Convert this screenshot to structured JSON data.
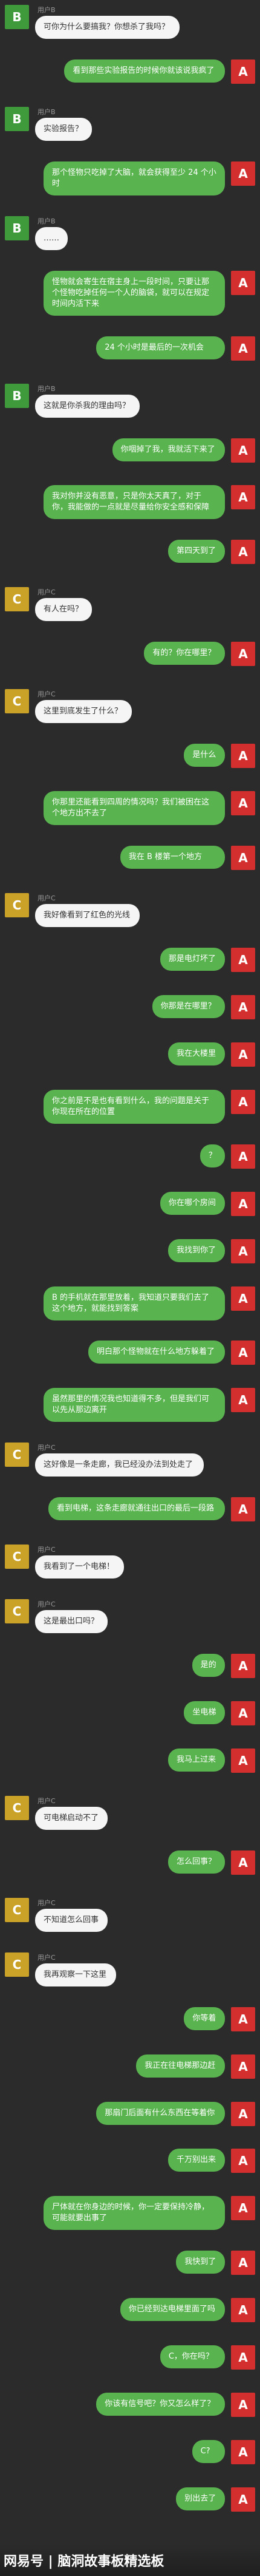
{
  "colors": {
    "background": "#2b2b2b",
    "green_avatar": "#3e9a3a",
    "red_avatar": "#d32f2f",
    "yellow_avatar": "#c9a227",
    "green_bubble": "#59b34f",
    "white_bubble": "#f5f5f5"
  },
  "messages": [
    {
      "side": "left",
      "avatar": "B",
      "avatar_color": "#3e9a3a",
      "name": "用户B",
      "text": "可你为什么要搞我？你想杀了我吗？"
    },
    {
      "side": "right",
      "avatar": "A",
      "avatar_color": "#d32f2f",
      "text": "看到那些实验报告的时候你就该说我疯了"
    },
    {
      "side": "left",
      "avatar": "B",
      "avatar_color": "#3e9a3a",
      "name": "用户B",
      "text": "实验报告？"
    },
    {
      "side": "right",
      "avatar": "A",
      "avatar_color": "#d32f2f",
      "text": "那个怪物只吃掉了大脑，就会获得至少 24 个小时"
    },
    {
      "side": "left",
      "avatar": "B",
      "avatar_color": "#3e9a3a",
      "name": "用户B",
      "text": "……"
    },
    {
      "side": "right",
      "avatar": "A",
      "avatar_color": "#d32f2f",
      "text": "怪物就会寄生在宿主身上一段时间，只要让那个怪物吃掉任何一个人的脑袋，就可以在规定时间内活下来"
    },
    {
      "side": "right",
      "avatar": "A",
      "avatar_color": "#d32f2f",
      "text": "24 个小时是最后的一次机会"
    },
    {
      "side": "left",
      "avatar": "B",
      "avatar_color": "#3e9a3a",
      "name": "用户B",
      "text": "这就是你杀我的理由吗？"
    },
    {
      "side": "right",
      "avatar": "A",
      "avatar_color": "#d32f2f",
      "text": "你咽掉了我，我就活下来了"
    },
    {
      "side": "right",
      "avatar": "A",
      "avatar_color": "#d32f2f",
      "text": "我对你并没有恶意，只是你太天真了，对于你，我能做的一点就是尽量给你安全感和保障"
    },
    {
      "side": "right",
      "avatar": "A",
      "avatar_color": "#d32f2f",
      "text": "第四天到了"
    },
    {
      "side": "left",
      "avatar": "C",
      "avatar_color": "#c9a227",
      "name": "用户C",
      "text": "有人在吗？"
    },
    {
      "side": "right",
      "avatar": "A",
      "avatar_color": "#d32f2f",
      "text": "有的？你在哪里？"
    },
    {
      "side": "left",
      "avatar": "C",
      "avatar_color": "#c9a227",
      "name": "用户C",
      "text": "这里到底发生了什么？"
    },
    {
      "side": "right",
      "avatar": "A",
      "avatar_color": "#d32f2f",
      "text": "是什么"
    },
    {
      "side": "right",
      "avatar": "A",
      "avatar_color": "#d32f2f",
      "text": "你那里还能看到四周的情况吗？我们被困在这个地方出不去了"
    },
    {
      "side": "right",
      "avatar": "A",
      "avatar_color": "#d32f2f",
      "text": "我在 B 楼第一个地方"
    },
    {
      "side": "left",
      "avatar": "C",
      "avatar_color": "#c9a227",
      "name": "用户C",
      "text": "我好像看到了红色的光线"
    },
    {
      "side": "right",
      "avatar": "A",
      "avatar_color": "#d32f2f",
      "text": "那是电灯坏了"
    },
    {
      "side": "right",
      "avatar": "A",
      "avatar_color": "#d32f2f",
      "text": "你那是在哪里？"
    },
    {
      "side": "right",
      "avatar": "A",
      "avatar_color": "#d32f2f",
      "text": "我在大楼里"
    },
    {
      "side": "right",
      "avatar": "A",
      "avatar_color": "#d32f2f",
      "text": "你之前是不是也有看到什么，我的问题是关于你现在所在的位置"
    },
    {
      "side": "right",
      "avatar": "A",
      "avatar_color": "#d32f2f",
      "text": "？"
    },
    {
      "side": "right",
      "avatar": "A",
      "avatar_color": "#d32f2f",
      "text": "你在哪个房间"
    },
    {
      "side": "right",
      "avatar": "A",
      "avatar_color": "#d32f2f",
      "text": "我找到你了"
    },
    {
      "side": "right",
      "avatar": "A",
      "avatar_color": "#d32f2f",
      "text": "B 的手机就在那里放着，我知道只要我们去了这个地方，就能找到答案"
    },
    {
      "side": "right",
      "avatar": "A",
      "avatar_color": "#d32f2f",
      "text": "明白那个怪物就在什么地方躲着了"
    },
    {
      "side": "right",
      "avatar": "A",
      "avatar_color": "#d32f2f",
      "text": "虽然那里的情况我也知道得不多，但是我们可以先从那边离开"
    },
    {
      "side": "left",
      "avatar": "C",
      "avatar_color": "#c9a227",
      "name": "用户C",
      "text": "这好像是一条走廊，我已经没办法到处走了"
    },
    {
      "side": "right",
      "avatar": "A",
      "avatar_color": "#d32f2f",
      "text": "看到电梯，这条走廊就通往出口的最后一段路"
    },
    {
      "side": "left",
      "avatar": "C",
      "avatar_color": "#c9a227",
      "name": "用户C",
      "text": "我看到了一个电梯！"
    },
    {
      "side": "left",
      "avatar": "C",
      "avatar_color": "#c9a227",
      "name": "用户C",
      "text": "这是最出口吗？"
    },
    {
      "side": "right",
      "avatar": "A",
      "avatar_color": "#d32f2f",
      "text": "是的"
    },
    {
      "side": "right",
      "avatar": "A",
      "avatar_color": "#d32f2f",
      "text": "坐电梯"
    },
    {
      "side": "right",
      "avatar": "A",
      "avatar_color": "#d32f2f",
      "text": "我马上过来"
    },
    {
      "side": "left",
      "avatar": "C",
      "avatar_color": "#c9a227",
      "name": "用户C",
      "text": "可电梯启动不了"
    },
    {
      "side": "right",
      "avatar": "A",
      "avatar_color": "#d32f2f",
      "text": "怎么回事？"
    },
    {
      "side": "left",
      "avatar": "C",
      "avatar_color": "#c9a227",
      "name": "用户C",
      "text": "不知道怎么回事"
    },
    {
      "side": "left",
      "avatar": "C",
      "avatar_color": "#c9a227",
      "name": "用户C",
      "text": "我再观察一下这里"
    },
    {
      "side": "right",
      "avatar": "A",
      "avatar_color": "#d32f2f",
      "text": "你等着"
    },
    {
      "side": "right",
      "avatar": "A",
      "avatar_color": "#d32f2f",
      "text": "我正在往电梯那边赶"
    },
    {
      "side": "right",
      "avatar": "A",
      "avatar_color": "#d32f2f",
      "text": "那扇门后面有什么东西在等着你"
    },
    {
      "side": "right",
      "avatar": "A",
      "avatar_color": "#d32f2f",
      "text": "千万别出来"
    },
    {
      "side": "right",
      "avatar": "A",
      "avatar_color": "#d32f2f",
      "text": "尸体就在你身边的时候，你一定要保持冷静，可能就要出事了"
    },
    {
      "side": "right",
      "avatar": "A",
      "avatar_color": "#d32f2f",
      "text": "我快到了"
    },
    {
      "side": "right",
      "avatar": "A",
      "avatar_color": "#d32f2f",
      "text": "你已经到达电梯里面了吗"
    },
    {
      "side": "right",
      "avatar": "A",
      "avatar_color": "#d32f2f",
      "text": "C，你在吗？"
    },
    {
      "side": "right",
      "avatar": "A",
      "avatar_color": "#d32f2f",
      "text": "你该有信号吧？你又怎么样了？"
    },
    {
      "side": "right",
      "avatar": "A",
      "avatar_color": "#d32f2f",
      "text": "C?"
    },
    {
      "side": "right",
      "avatar": "A",
      "avatar_color": "#d32f2f",
      "text": "别出去了"
    }
  ],
  "watermark": "网易号 | 脑洞故事板精选板"
}
